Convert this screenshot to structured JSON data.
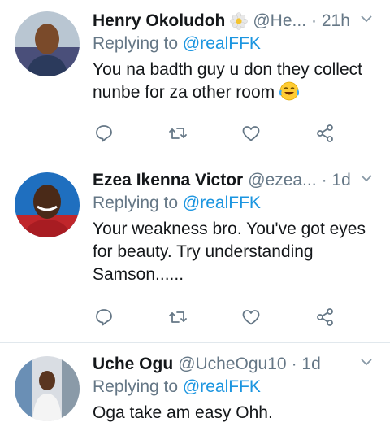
{
  "tweets": [
    {
      "name": "Henry Okoludoh",
      "handle": "@He...",
      "time": "· 21h",
      "reply_prefix": "Replying to ",
      "reply_to": "@realFFK",
      "text": "You na badth guy u don they collect nunbe for za other room",
      "emoji": "face-with-tears-of-joy"
    },
    {
      "name": "Ezea Ikenna Victor",
      "handle": "@ezea...",
      "time": "· 1d",
      "reply_prefix": "Replying to ",
      "reply_to": "@realFFK",
      "text": "Your weakness bro. You've got eyes for beauty. Try understanding Samson......"
    },
    {
      "name": "Uche Ogu",
      "handle": "@UcheOgu10",
      "time": "· 1d",
      "reply_prefix": "Replying to ",
      "reply_to": "@realFFK",
      "text": "Oga take am easy Ohh."
    }
  ],
  "icons": [
    "reply-icon",
    "retweet-icon",
    "like-icon",
    "share-icon",
    "chevron-down-icon"
  ],
  "colors": {
    "text": "#14171a",
    "muted": "#657786",
    "link": "#1b95e0",
    "divider": "#e1e8ed"
  }
}
